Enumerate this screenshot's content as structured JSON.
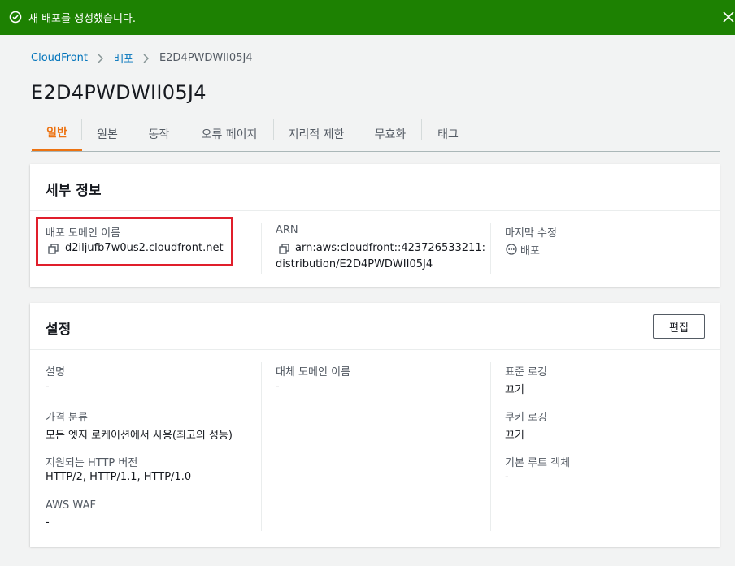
{
  "flash": {
    "message": "새 배포를 생성했습니다."
  },
  "breadcrumb": {
    "root": "CloudFront",
    "parent": "배포",
    "current": "E2D4PWDWII05J4"
  },
  "page_title": "E2D4PWDWII05J4",
  "tabs": [
    "일반",
    "원본",
    "동작",
    "오류 페이지",
    "지리적 제한",
    "무효화",
    "태그"
  ],
  "details": {
    "title": "세부 정보",
    "domain_label": "배포 도메인 이름",
    "domain_value": "d2iljufb7w0us2.cloudfront.net",
    "arn_label": "ARN",
    "arn_line1": "arn:aws:cloudfront::423726533211:",
    "arn_line2": "distribution/E2D4PWDWII05J4",
    "modified_label": "마지막 수정",
    "modified_value": "배포"
  },
  "settings": {
    "title": "설정",
    "edit_label": "편집",
    "description_label": "설명",
    "description_value": "-",
    "price_label": "가격 분류",
    "price_value": "모든 엣지 로케이션에서 사용(최고의 성능)",
    "http_label": "지원되는 HTTP 버전",
    "http_value": "HTTP/2, HTTP/1.1, HTTP/1.0",
    "waf_label": "AWS WAF",
    "waf_value": "-",
    "alt_domain_label": "대체 도메인 이름",
    "alt_domain_value": "-",
    "std_log_label": "표준 로깅",
    "std_log_value": "끄기",
    "cookie_log_label": "쿠키 로깅",
    "cookie_log_value": "끄기",
    "root_obj_label": "기본 루트 객체",
    "root_obj_value": "-"
  }
}
